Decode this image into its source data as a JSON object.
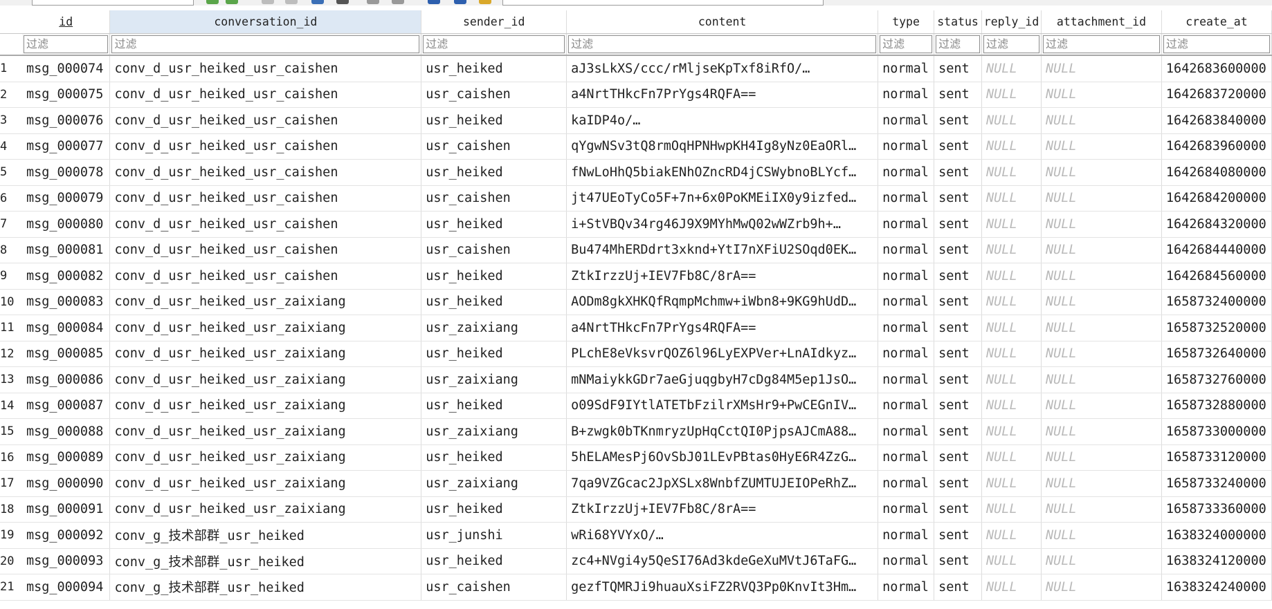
{
  "columns": [
    {
      "key": "id",
      "label": "id"
    },
    {
      "key": "conversation_id",
      "label": "conversation_id"
    },
    {
      "key": "sender_id",
      "label": "sender_id"
    },
    {
      "key": "content",
      "label": "content"
    },
    {
      "key": "type",
      "label": "type"
    },
    {
      "key": "status",
      "label": "status"
    },
    {
      "key": "reply_id",
      "label": "reply_id"
    },
    {
      "key": "attachment_id",
      "label": "attachment_id"
    },
    {
      "key": "create_at",
      "label": "create_at"
    }
  ],
  "filter_placeholder": "过滤",
  "rows": [
    {
      "n": "1",
      "id": "msg_000074",
      "conversation_id": "conv_d_usr_heiked_usr_caishen",
      "sender_id": "usr_heiked",
      "content": "aJ3sLkXS/ccc/rMljseKpTxf8iRfO/…",
      "type": "normal",
      "status": "sent",
      "reply_id": "NULL",
      "attachment_id": "NULL",
      "create_at": "1642683600000"
    },
    {
      "n": "2",
      "id": "msg_000075",
      "conversation_id": "conv_d_usr_heiked_usr_caishen",
      "sender_id": "usr_caishen",
      "content": "a4NrtTHkcFn7PrYgs4RQFA==",
      "type": "normal",
      "status": "sent",
      "reply_id": "NULL",
      "attachment_id": "NULL",
      "create_at": "1642683720000"
    },
    {
      "n": "3",
      "id": "msg_000076",
      "conversation_id": "conv_d_usr_heiked_usr_caishen",
      "sender_id": "usr_heiked",
      "content": "kaIDP4o/…",
      "type": "normal",
      "status": "sent",
      "reply_id": "NULL",
      "attachment_id": "NULL",
      "create_at": "1642683840000"
    },
    {
      "n": "4",
      "id": "msg_000077",
      "conversation_id": "conv_d_usr_heiked_usr_caishen",
      "sender_id": "usr_caishen",
      "content": "qYgwNSv3tQ8rmOqHPNHwpKH4Ig8yNz0EaORl…",
      "type": "normal",
      "status": "sent",
      "reply_id": "NULL",
      "attachment_id": "NULL",
      "create_at": "1642683960000"
    },
    {
      "n": "5",
      "id": "msg_000078",
      "conversation_id": "conv_d_usr_heiked_usr_caishen",
      "sender_id": "usr_heiked",
      "content": "fNwLoHhQ5biakENhOZncRD4jCSWybnoBLYcf…",
      "type": "normal",
      "status": "sent",
      "reply_id": "NULL",
      "attachment_id": "NULL",
      "create_at": "1642684080000"
    },
    {
      "n": "6",
      "id": "msg_000079",
      "conversation_id": "conv_d_usr_heiked_usr_caishen",
      "sender_id": "usr_caishen",
      "content": "jt47UEoTyCo5F+7n+6x0PoKMEiIX0y9izfed…",
      "type": "normal",
      "status": "sent",
      "reply_id": "NULL",
      "attachment_id": "NULL",
      "create_at": "1642684200000"
    },
    {
      "n": "7",
      "id": "msg_000080",
      "conversation_id": "conv_d_usr_heiked_usr_caishen",
      "sender_id": "usr_heiked",
      "content": "i+StVBQv34rg46J9X9MYhMwQ02wWZrb9h+…",
      "type": "normal",
      "status": "sent",
      "reply_id": "NULL",
      "attachment_id": "NULL",
      "create_at": "1642684320000"
    },
    {
      "n": "8",
      "id": "msg_000081",
      "conversation_id": "conv_d_usr_heiked_usr_caishen",
      "sender_id": "usr_caishen",
      "content": "Bu474MhERDdrt3xknd+YtI7nXFiU2SOqd0EK…",
      "type": "normal",
      "status": "sent",
      "reply_id": "NULL",
      "attachment_id": "NULL",
      "create_at": "1642684440000"
    },
    {
      "n": "9",
      "id": "msg_000082",
      "conversation_id": "conv_d_usr_heiked_usr_caishen",
      "sender_id": "usr_heiked",
      "content": "ZtkIrzzUj+IEV7Fb8C/8rA==",
      "type": "normal",
      "status": "sent",
      "reply_id": "NULL",
      "attachment_id": "NULL",
      "create_at": "1642684560000"
    },
    {
      "n": "10",
      "id": "msg_000083",
      "conversation_id": "conv_d_usr_heiked_usr_zaixiang",
      "sender_id": "usr_heiked",
      "content": "AODm8gkXHKQfRqmpMchmw+iWbn8+9KG9hUdD…",
      "type": "normal",
      "status": "sent",
      "reply_id": "NULL",
      "attachment_id": "NULL",
      "create_at": "1658732400000"
    },
    {
      "n": "11",
      "id": "msg_000084",
      "conversation_id": "conv_d_usr_heiked_usr_zaixiang",
      "sender_id": "usr_zaixiang",
      "content": "a4NrtTHkcFn7PrYgs4RQFA==",
      "type": "normal",
      "status": "sent",
      "reply_id": "NULL",
      "attachment_id": "NULL",
      "create_at": "1658732520000"
    },
    {
      "n": "12",
      "id": "msg_000085",
      "conversation_id": "conv_d_usr_heiked_usr_zaixiang",
      "sender_id": "usr_heiked",
      "content": "PLchE8eVksvrQOZ6l96LyEXPVer+LnAIdkyz…",
      "type": "normal",
      "status": "sent",
      "reply_id": "NULL",
      "attachment_id": "NULL",
      "create_at": "1658732640000"
    },
    {
      "n": "13",
      "id": "msg_000086",
      "conversation_id": "conv_d_usr_heiked_usr_zaixiang",
      "sender_id": "usr_zaixiang",
      "content": "mNMaiykkGDr7aeGjuqgbyH7cDg84M5ep1JsO…",
      "type": "normal",
      "status": "sent",
      "reply_id": "NULL",
      "attachment_id": "NULL",
      "create_at": "1658732760000"
    },
    {
      "n": "14",
      "id": "msg_000087",
      "conversation_id": "conv_d_usr_heiked_usr_zaixiang",
      "sender_id": "usr_heiked",
      "content": "o09SdF9IYtlATETbFzilrXMsHr9+PwCEGnIV…",
      "type": "normal",
      "status": "sent",
      "reply_id": "NULL",
      "attachment_id": "NULL",
      "create_at": "1658732880000"
    },
    {
      "n": "15",
      "id": "msg_000088",
      "conversation_id": "conv_d_usr_heiked_usr_zaixiang",
      "sender_id": "usr_zaixiang",
      "content": "B+zwgk0bTKnmryzUpHqCctQI0PjpsAJCmA88…",
      "type": "normal",
      "status": "sent",
      "reply_id": "NULL",
      "attachment_id": "NULL",
      "create_at": "1658733000000"
    },
    {
      "n": "16",
      "id": "msg_000089",
      "conversation_id": "conv_d_usr_heiked_usr_zaixiang",
      "sender_id": "usr_heiked",
      "content": "5hELAMesPj6OvSbJ01LEvPBtas0HyE6R4ZzG…",
      "type": "normal",
      "status": "sent",
      "reply_id": "NULL",
      "attachment_id": "NULL",
      "create_at": "1658733120000"
    },
    {
      "n": "17",
      "id": "msg_000090",
      "conversation_id": "conv_d_usr_heiked_usr_zaixiang",
      "sender_id": "usr_zaixiang",
      "content": "7qa9VZGcac2JpXSLx8WnbfZUMTUJEIOPeRhZ…",
      "type": "normal",
      "status": "sent",
      "reply_id": "NULL",
      "attachment_id": "NULL",
      "create_at": "1658733240000"
    },
    {
      "n": "18",
      "id": "msg_000091",
      "conversation_id": "conv_d_usr_heiked_usr_zaixiang",
      "sender_id": "usr_heiked",
      "content": "ZtkIrzzUj+IEV7Fb8C/8rA==",
      "type": "normal",
      "status": "sent",
      "reply_id": "NULL",
      "attachment_id": "NULL",
      "create_at": "1658733360000"
    },
    {
      "n": "19",
      "id": "msg_000092",
      "conversation_id": "conv_g_技术部群_usr_heiked",
      "sender_id": "usr_junshi",
      "content": "wRi68YVYxO/…",
      "type": "normal",
      "status": "sent",
      "reply_id": "NULL",
      "attachment_id": "NULL",
      "create_at": "1638324000000"
    },
    {
      "n": "20",
      "id": "msg_000093",
      "conversation_id": "conv_g_技术部群_usr_heiked",
      "sender_id": "usr_heiked",
      "content": "zc4+NVgi4y5QeSI76Ad3kdeGeXuMVtJ6TaFG…",
      "type": "normal",
      "status": "sent",
      "reply_id": "NULL",
      "attachment_id": "NULL",
      "create_at": "1638324120000"
    },
    {
      "n": "21",
      "id": "msg_000094",
      "conversation_id": "conv_g_技术部群_usr_heiked",
      "sender_id": "usr_caishen",
      "content": "gezfTQMRJi9huauXsiFZ2RVQ3Pp0KnvIt3Hm…",
      "type": "normal",
      "status": "sent",
      "reply_id": "NULL",
      "attachment_id": "NULL",
      "create_at": "1638324240000"
    }
  ]
}
